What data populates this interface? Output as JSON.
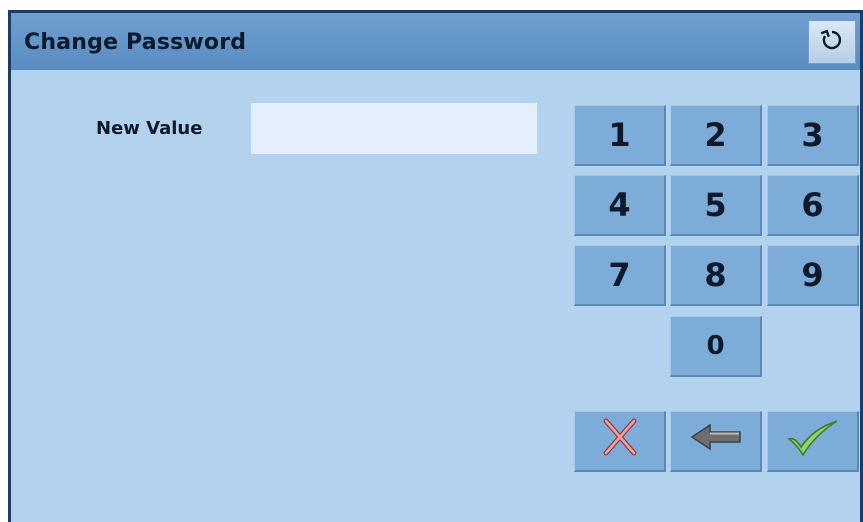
{
  "dialog": {
    "title": "Change Password",
    "refresh_icon": "refresh-icon"
  },
  "field": {
    "label": "New Value",
    "value": ""
  },
  "keypad": {
    "keys": [
      "1",
      "2",
      "3",
      "4",
      "5",
      "6",
      "7",
      "8",
      "9",
      "0"
    ]
  },
  "actions": {
    "cancel_icon": "cancel-x-icon",
    "backspace_icon": "backspace-arrow-icon",
    "confirm_icon": "confirm-check-icon"
  },
  "colors": {
    "titlebar": "#5a8cc2",
    "background": "#b3d2ed",
    "key": "#7eacd8",
    "input": "#e3f0fb"
  }
}
